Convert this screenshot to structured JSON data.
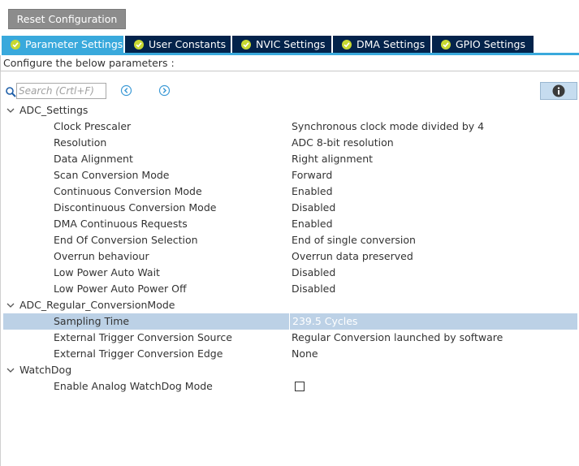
{
  "toolbar": {
    "reset_label": "Reset Configuration"
  },
  "tabs": [
    {
      "label": "Parameter Settings",
      "active": true
    },
    {
      "label": "User Constants",
      "active": false
    },
    {
      "label": "NVIC Settings",
      "active": false
    },
    {
      "label": "DMA Settings",
      "active": false
    },
    {
      "label": "GPIO Settings",
      "active": false
    }
  ],
  "configure_text": "Configure the below parameters :",
  "search": {
    "placeholder": "Search (Crtl+F)"
  },
  "icons": {
    "search": "search-icon",
    "prev": "circle-chevron-left-icon",
    "next": "circle-chevron-right-icon",
    "info": "info-icon",
    "tab_check": "check-circle-icon"
  },
  "colors": {
    "tab_active": "#39a9dc",
    "tab_inactive": "#03234b",
    "tab_check": "#c8d832",
    "selected_row": "#bcd1e6",
    "reset_button": "#8c8c8c"
  },
  "groups": {
    "adc_settings": {
      "label": "ADC_Settings",
      "rows": [
        {
          "label": "Clock Prescaler",
          "value": "Synchronous clock mode divided by 4"
        },
        {
          "label": "Resolution",
          "value": "ADC 8-bit resolution"
        },
        {
          "label": "Data Alignment",
          "value": "Right alignment"
        },
        {
          "label": "Scan Conversion Mode",
          "value": "Forward"
        },
        {
          "label": "Continuous Conversion Mode",
          "value": "Enabled"
        },
        {
          "label": "Discontinuous Conversion Mode",
          "value": "Disabled"
        },
        {
          "label": "DMA Continuous Requests",
          "value": "Enabled"
        },
        {
          "label": "End Of Conversion Selection",
          "value": "End of single conversion"
        },
        {
          "label": "Overrun behaviour",
          "value": "Overrun data preserved"
        },
        {
          "label": "Low Power Auto Wait",
          "value": "Disabled"
        },
        {
          "label": "Low Power Auto Power Off",
          "value": "Disabled"
        }
      ]
    },
    "adc_regular": {
      "label": "ADC_Regular_ConversionMode",
      "rows": [
        {
          "label": "Sampling Time",
          "value": "239.5 Cycles",
          "selected": true
        },
        {
          "label": "External Trigger Conversion Source",
          "value": "Regular Conversion launched by software"
        },
        {
          "label": "External Trigger Conversion Edge",
          "value": "None"
        }
      ]
    },
    "watchdog": {
      "label": "WatchDog",
      "rows": [
        {
          "label": "Enable Analog WatchDog Mode",
          "checked": false
        }
      ]
    }
  }
}
